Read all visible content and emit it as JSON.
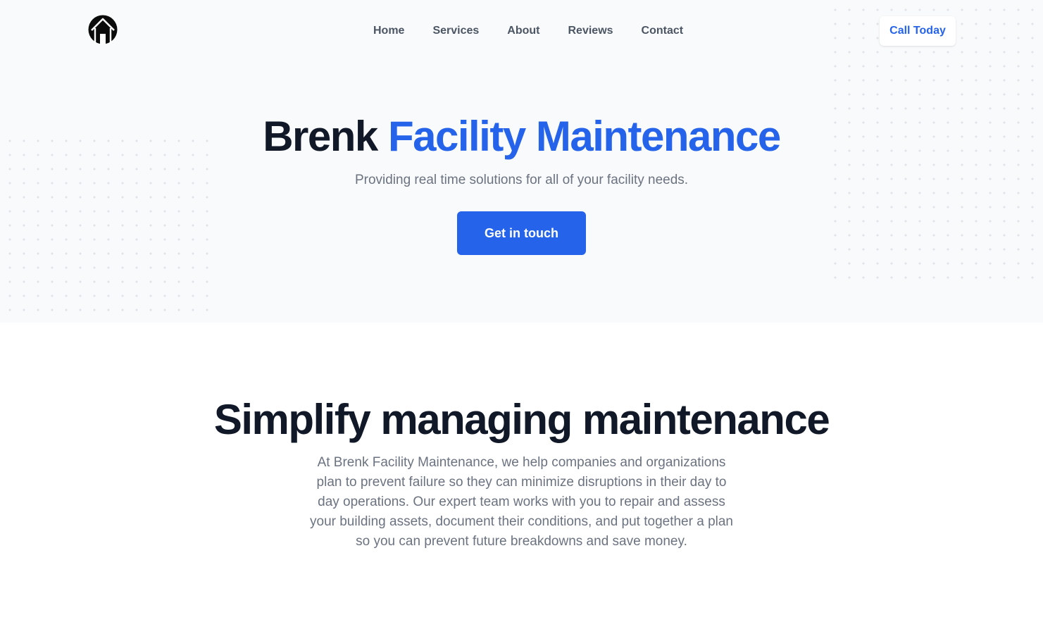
{
  "header": {
    "logo_icon": "house-circle-icon",
    "nav": [
      {
        "label": "Home"
      },
      {
        "label": "Services"
      },
      {
        "label": "About"
      },
      {
        "label": "Reviews"
      },
      {
        "label": "Contact"
      }
    ],
    "call_label": "Call Today"
  },
  "hero": {
    "title_main": "Brenk",
    "title_accent": "Facility Maintenance",
    "subtitle": "Providing real time solutions for all of your facility needs.",
    "cta_label": "Get in touch"
  },
  "about": {
    "title": "Simplify managing maintenance",
    "body": "At Brenk Facility Maintenance, we help companies and organizations plan to prevent failure so they can minimize disruptions in their day to day operations. Our expert team works with you to repair and assess your building assets, document their conditions, and put together a plan so you can prevent future breakdowns and save money."
  },
  "colors": {
    "accent": "#2563eb",
    "heading": "#111827",
    "muted": "#6b7280",
    "hero_bg": "#f9fafb"
  }
}
